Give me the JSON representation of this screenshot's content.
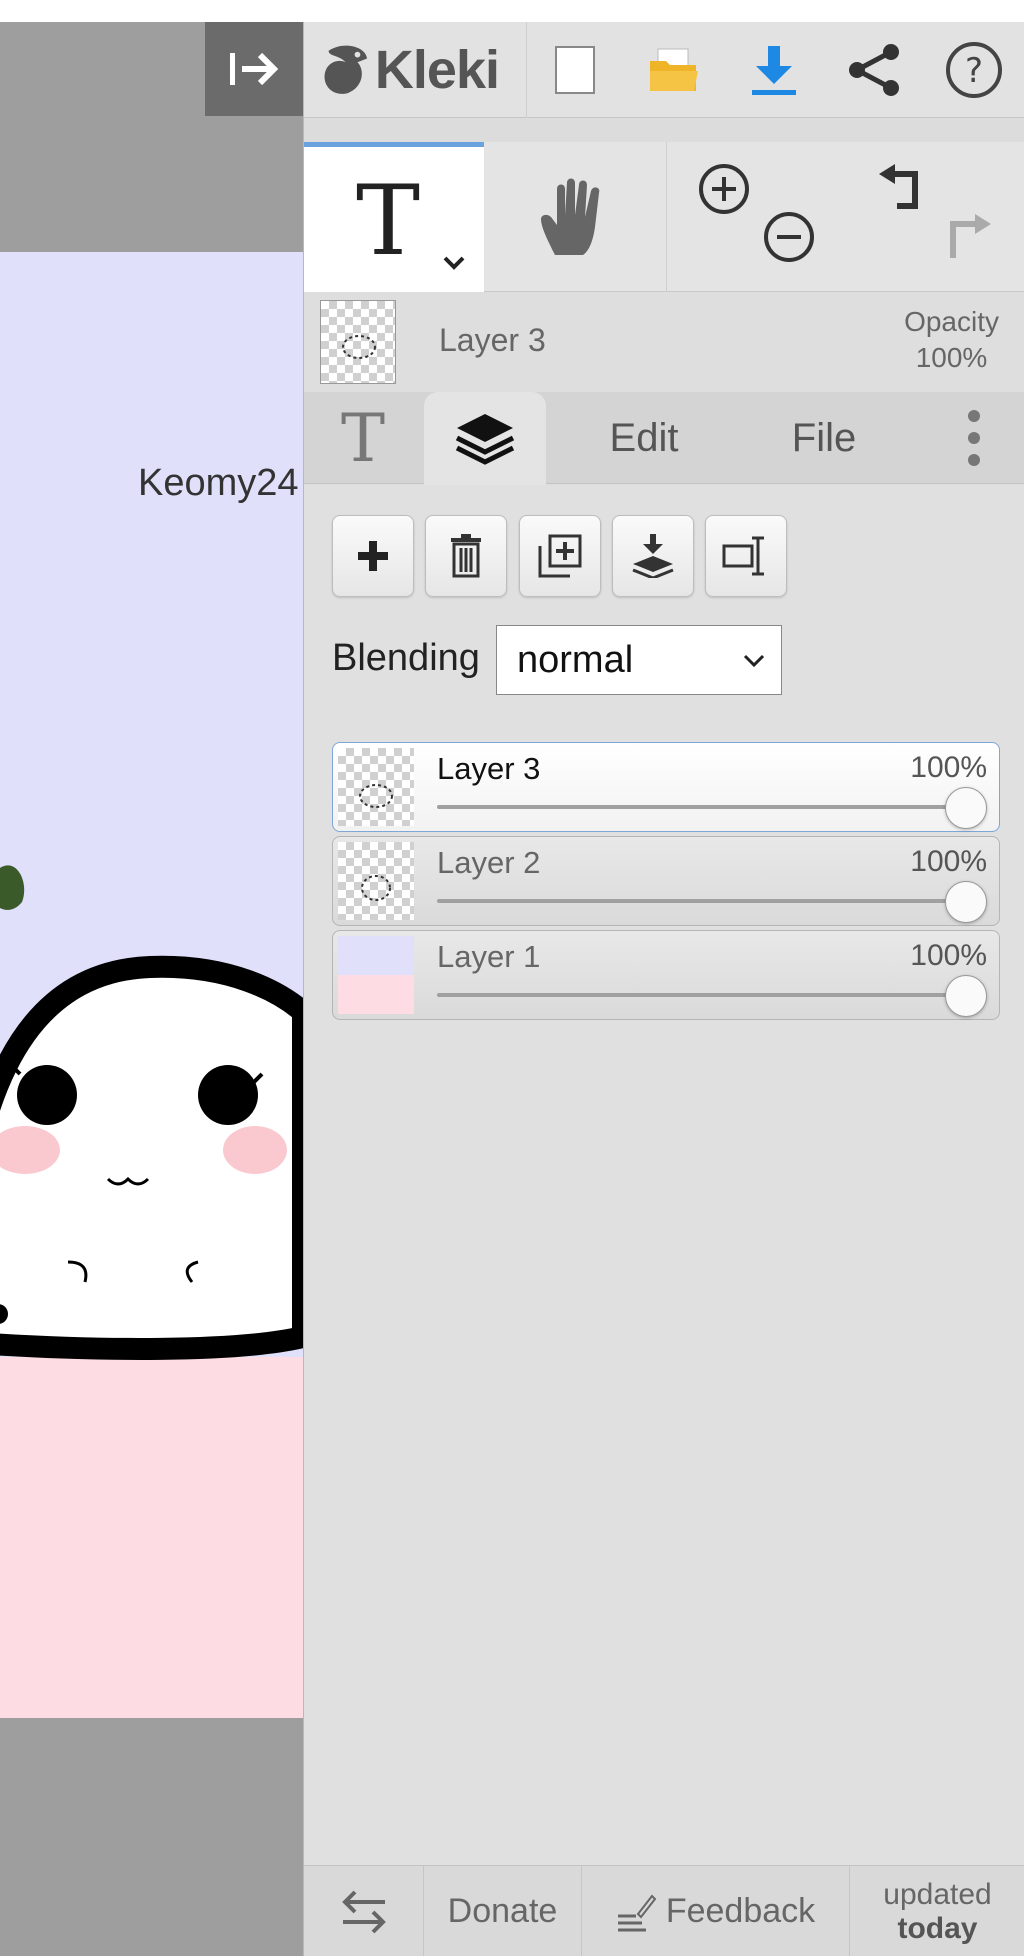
{
  "canvas": {
    "collapse_icon": "collapse-panel-icon",
    "drawing_text": "Keomy24",
    "colors": {
      "bg_top": "#e0e0fb",
      "bg_bottom": "#fddde3",
      "gutter": "#9e9e9e"
    }
  },
  "topbar": {
    "logo_text": "Kleki",
    "buttons": [
      "new-image-icon",
      "open-folder-icon",
      "download-icon",
      "share-icon",
      "help-icon"
    ],
    "accent": "#1e88e5"
  },
  "tools": {
    "active_tool_glyph": "T",
    "items": [
      "text-tool",
      "hand-tool",
      "zoom-in",
      "zoom-out",
      "undo",
      "redo"
    ]
  },
  "current_layer": {
    "name": "Layer 3",
    "opacity_label": "Opacity",
    "opacity_value": "100%"
  },
  "tabs": {
    "text_glyph": "T",
    "edit": "Edit",
    "file": "File"
  },
  "layers_panel": {
    "buttons": [
      "add-layer",
      "delete-layer",
      "duplicate-layer",
      "merge-down",
      "rename-layer"
    ],
    "blending_label": "Blending",
    "blending_value": "normal",
    "layers": [
      {
        "name": "Layer 3",
        "opacity": "100%",
        "active": true,
        "opacity_fraction": 1.0
      },
      {
        "name": "Layer 2",
        "opacity": "100%",
        "active": false,
        "opacity_fraction": 1.0
      },
      {
        "name": "Layer 1",
        "opacity": "100%",
        "active": false,
        "opacity_fraction": 1.0
      }
    ]
  },
  "footer": {
    "donate": "Donate",
    "feedback": "Feedback",
    "updated_line1": "updated",
    "updated_line2": "today"
  }
}
